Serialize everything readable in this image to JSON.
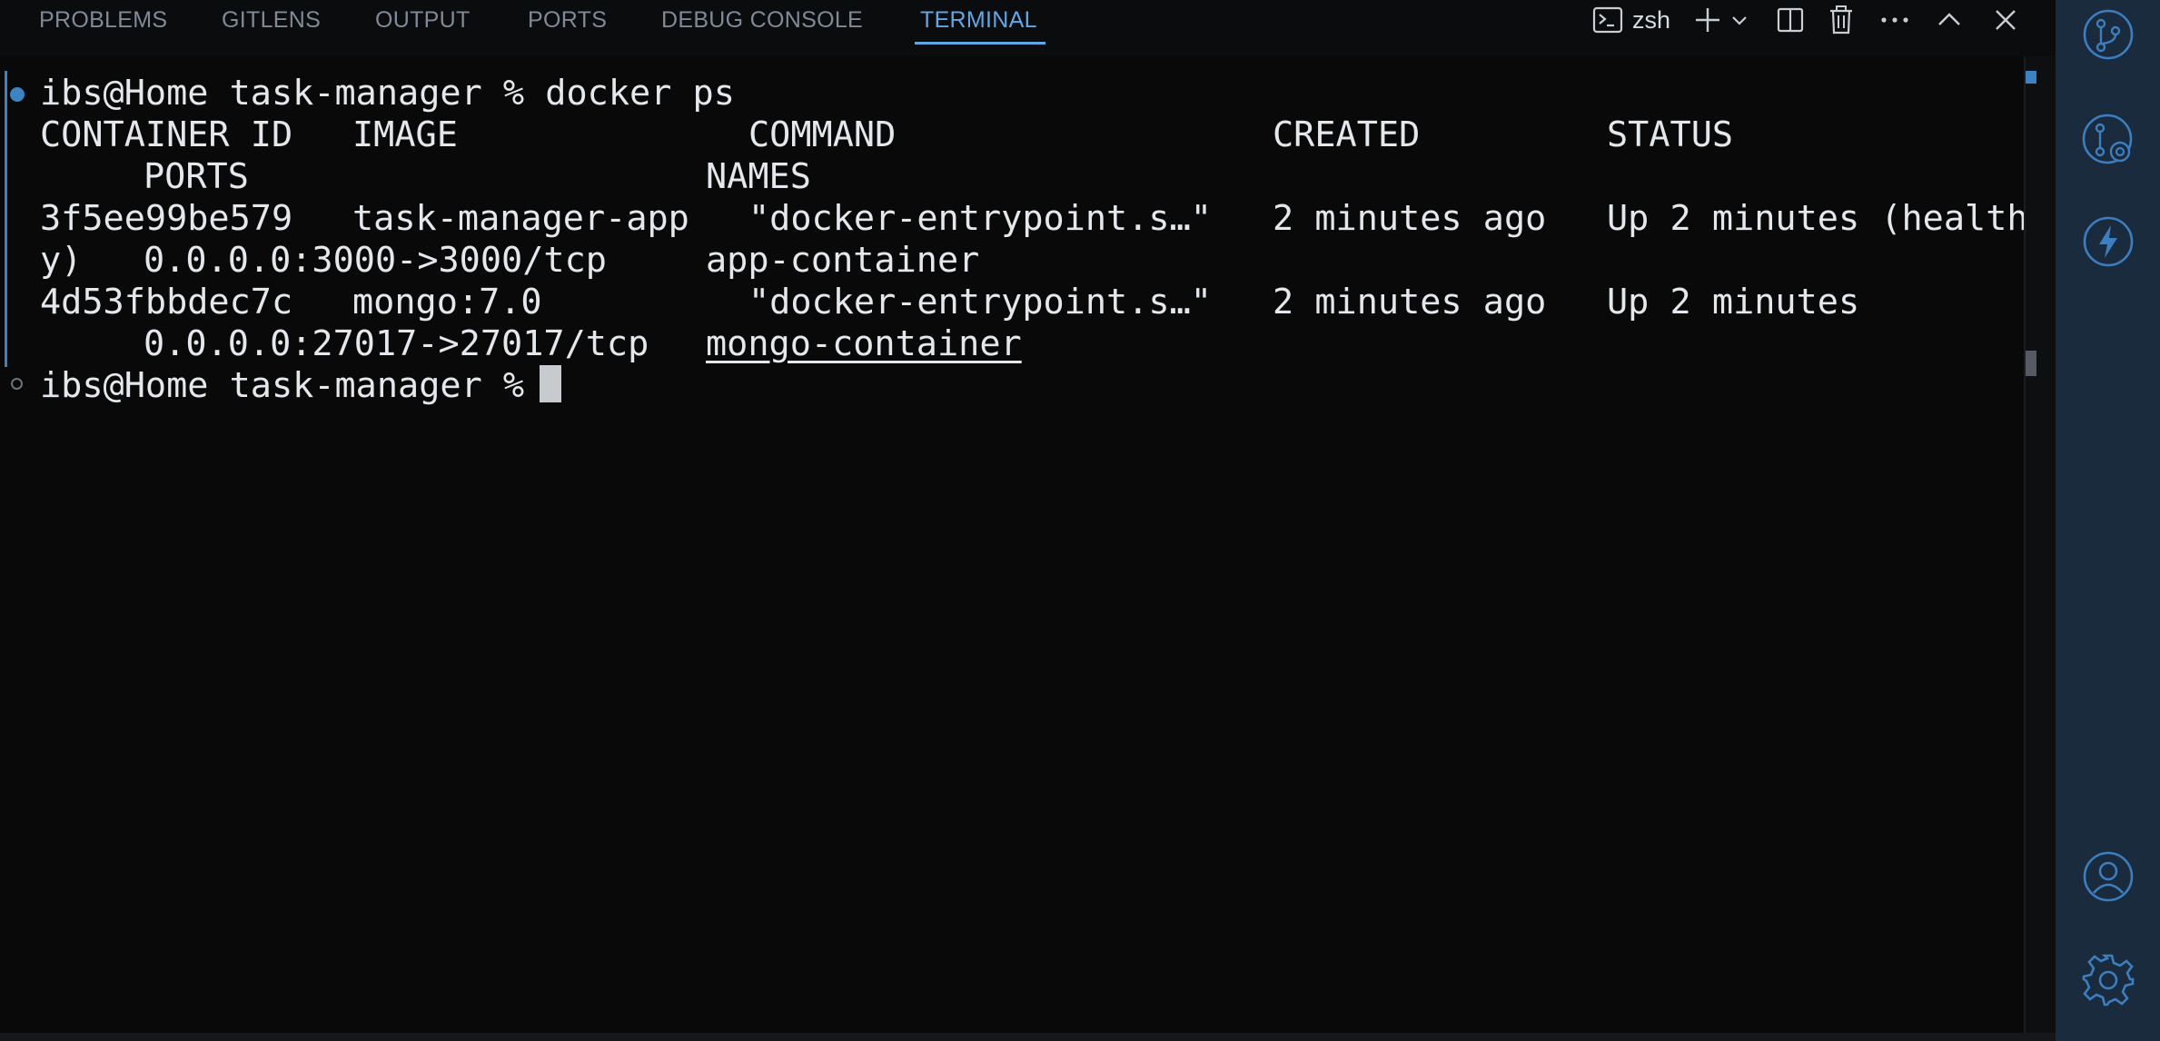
{
  "panel": {
    "tabs": [
      {
        "label": "PROBLEMS",
        "active": false
      },
      {
        "label": "GITLENS",
        "active": false
      },
      {
        "label": "OUTPUT",
        "active": false
      },
      {
        "label": "PORTS",
        "active": false
      },
      {
        "label": "DEBUG CONSOLE",
        "active": false
      },
      {
        "label": "TERMINAL",
        "active": true
      }
    ],
    "shell": "zsh",
    "icons": [
      "terminal-icon",
      "plus-icon",
      "chevron-down-icon",
      "split-icon",
      "trash-icon",
      "more-icon",
      "chevron-up-icon",
      "close-icon"
    ]
  },
  "terminal": {
    "prompt1": "ibs@Home task-manager % docker ps",
    "header": {
      "container_id": "CONTAINER ID",
      "image": "IMAGE",
      "command": "COMMAND",
      "created": "CREATED",
      "status": "STATUS",
      "ports": "PORTS",
      "names": "NAMES"
    },
    "rows": [
      {
        "id": "3f5ee99be579",
        "image": "task-manager-app",
        "command": "\"docker-entrypoint.s…\"",
        "created": "2 minutes ago",
        "status": "Up 2 minutes (health",
        "status_wrap": "y)",
        "ports": "0.0.0.0:3000->3000/tcp",
        "name": "app-container"
      },
      {
        "id": "4d53fbbdec7c",
        "image": "mongo:7.0",
        "command": "\"docker-entrypoint.s…\"",
        "created": "2 minutes ago",
        "status": "Up 2 minutes",
        "ports": "0.0.0.0:27017->27017/tcp",
        "name": "mongo-container"
      }
    ],
    "prompt2": "ibs@Home task-manager % "
  },
  "activity_bar": {
    "icons": [
      "source-control-icon",
      "git-graph-icon",
      "lightning-icon",
      "account-icon",
      "settings-gear-icon"
    ]
  },
  "colors": {
    "accent": "#5fa8e8",
    "background": "#090909",
    "activity_bar": "#1b2b3e"
  }
}
